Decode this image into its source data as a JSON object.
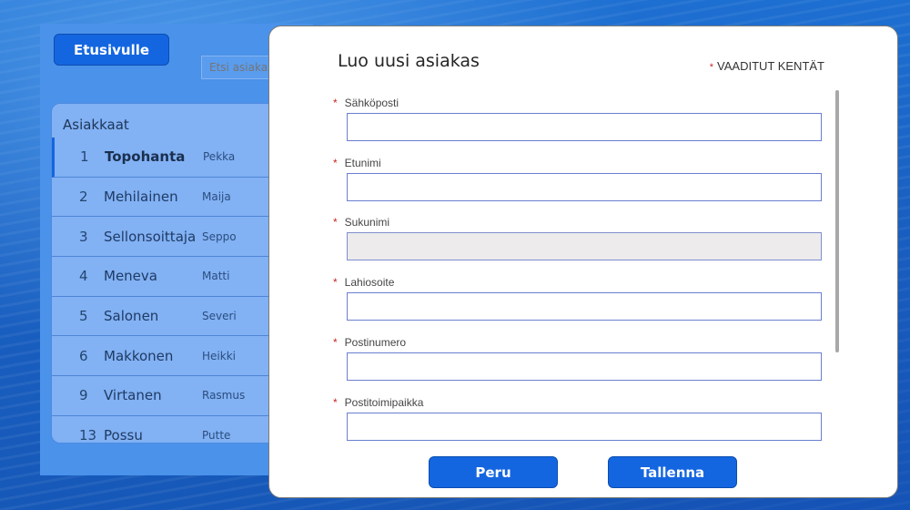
{
  "app": {
    "home_button": "Etusivulle",
    "search_placeholder": "Etsi asiakas"
  },
  "customers": {
    "title": "Asiakkaat",
    "items": [
      {
        "num": "1",
        "name": "Topohanta",
        "first": "Pekka",
        "selected": true
      },
      {
        "num": "2",
        "name": "Mehilainen",
        "first": "Maija"
      },
      {
        "num": "3",
        "name": "Sellonsoittaja",
        "first": "Seppo"
      },
      {
        "num": "4",
        "name": "Meneva",
        "first": "Matti"
      },
      {
        "num": "5",
        "name": "Salonen",
        "first": "Severi"
      },
      {
        "num": "6",
        "name": "Makkonen",
        "first": "Heikki"
      },
      {
        "num": "9",
        "name": "Virtanen",
        "first": "Rasmus"
      },
      {
        "num": "13",
        "name": "Possu",
        "first": "Putte"
      }
    ]
  },
  "modal": {
    "title": "Luo uusi asiakas",
    "required_star": "*",
    "required_legend": "VAADITUT KENTÄT",
    "fields": [
      {
        "label": "Sähköposti",
        "value": "",
        "disabled": false
      },
      {
        "label": "Etunimi",
        "value": "",
        "disabled": false
      },
      {
        "label": "Sukunimi",
        "value": "",
        "disabled": true
      },
      {
        "label": "Lahiosoite",
        "value": "",
        "disabled": false
      },
      {
        "label": "Postinumero",
        "value": "",
        "disabled": false
      },
      {
        "label": "Postitoimipaikka",
        "value": "",
        "disabled": false
      }
    ],
    "cancel_button": "Peru",
    "save_button": "Tallenna"
  }
}
